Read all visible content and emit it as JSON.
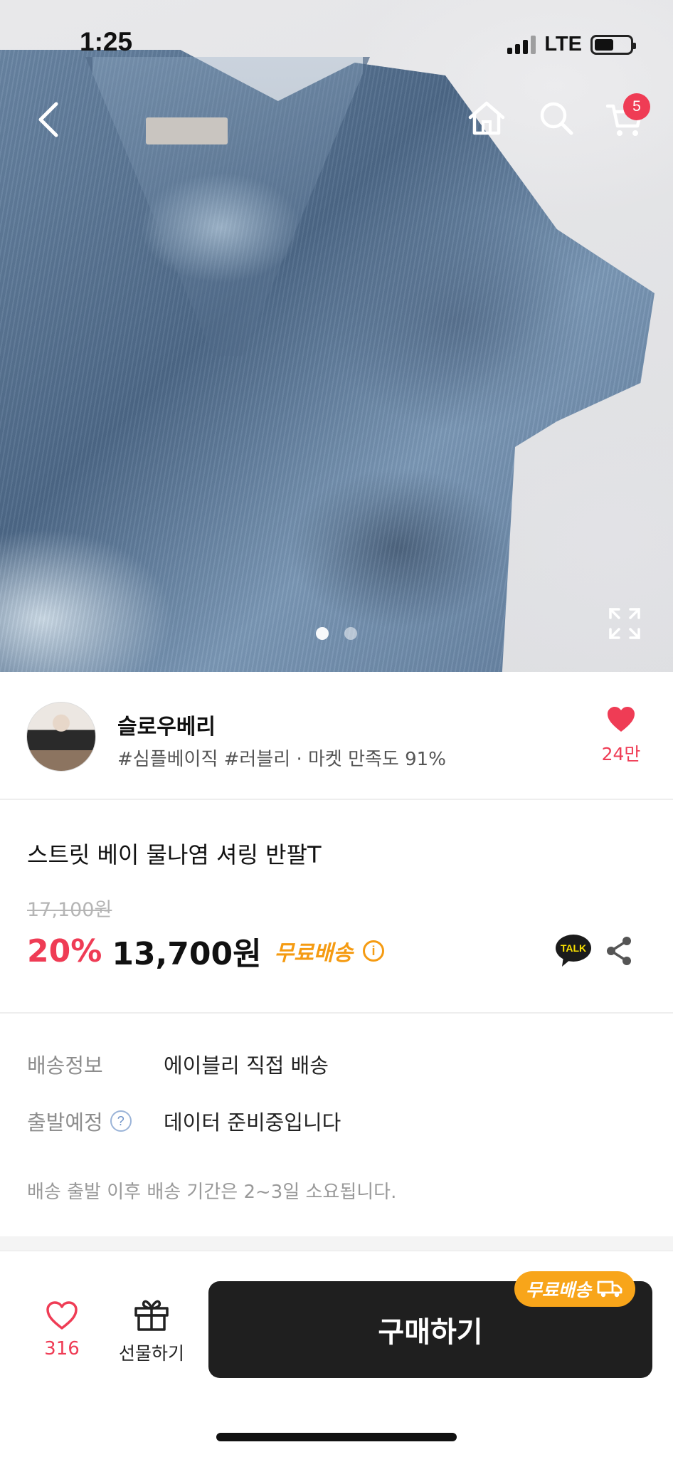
{
  "status_bar": {
    "time": "1:25",
    "network": "LTE"
  },
  "top_nav": {
    "cart_count": "5"
  },
  "gallery": {
    "total_images": 2,
    "current_index": 1
  },
  "seller": {
    "name": "슬로우베리",
    "tags": "#심플베이직 #러블리 · 마켓 만족도 91%",
    "likes": "24만"
  },
  "product": {
    "title": "스트릿 베이 물나염 셔링 반팔T",
    "original_price": "17,100원",
    "discount": "20%",
    "price": "13,700원",
    "free_shipping": "무료배송",
    "talk_label": "TALK"
  },
  "delivery": {
    "info_label": "배송정보",
    "info_value": "에이블리 직접 배송",
    "departure_label": "출발예정",
    "departure_help": "?",
    "departure_value": "데이터 준비중입니다",
    "note": "배송 출발 이후 배송 기간은 2~3일 소요됩니다."
  },
  "bottom_bar": {
    "wish_count": "316",
    "gift_label": "선물하기",
    "buy_label": "구매하기",
    "ship_badge": "무료배송"
  },
  "colors": {
    "accent_red": "#ef3c55",
    "accent_orange": "#f59b12",
    "buy_button": "#1f1f1f"
  },
  "icons": [
    "back-icon",
    "home-icon",
    "search-icon",
    "cart-icon",
    "expand-icon",
    "heart-icon",
    "kakao-talk-icon",
    "share-icon",
    "gift-icon",
    "truck-icon",
    "info-icon",
    "help-icon"
  ]
}
